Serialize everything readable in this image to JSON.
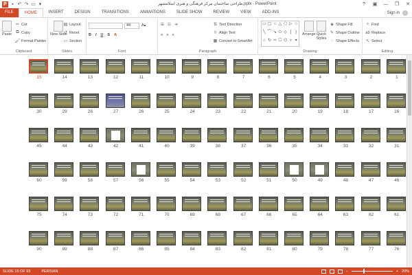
{
  "window": {
    "title": "طراحی ساختمان مرکز فرهنگی و هنری اسلامشهر.pptx - PowerPoint",
    "sign_in": "Sign in",
    "minimize": "—",
    "restore": "❐",
    "close": "✕",
    "help": "?"
  },
  "tabs": [
    "FILE",
    "HOME",
    "INSERT",
    "DESIGN",
    "TRANSITIONS",
    "ANIMATIONS",
    "SLIDE SHOW",
    "REVIEW",
    "VIEW",
    "ADD-INS"
  ],
  "ribbon": {
    "clipboard": {
      "label": "Clipboard",
      "paste": "Paste",
      "cut": "Cut",
      "copy": "Copy",
      "format_painter": "Format Painter"
    },
    "slides": {
      "label": "Slides",
      "new_slide": "New Slide",
      "layout": "Layout",
      "reset": "Reset",
      "section": "Section"
    },
    "font": {
      "label": "Font",
      "font_name": "",
      "font_size": "44"
    },
    "paragraph": {
      "label": "Paragraph",
      "text_direction": "Text Direction",
      "align_text": "Align Text",
      "convert_smartart": "Convert to SmartArt"
    },
    "drawing": {
      "label": "Drawing",
      "arrange": "Arrange",
      "quick_styles": "Quick Styles",
      "shape_fill": "Shape Fill",
      "shape_outline": "Shape Outline",
      "shape_effects": "Shape Effects"
    },
    "editing": {
      "label": "Editing",
      "find": "Find",
      "replace": "Replace",
      "select": "Select"
    }
  },
  "slides": {
    "selected": 15,
    "white_slides": [
      42,
      49,
      50,
      56
    ],
    "blue_slides": [
      27
    ],
    "numbers": [
      15,
      14,
      13,
      12,
      11,
      10,
      9,
      8,
      7,
      6,
      5,
      4,
      3,
      2,
      1,
      30,
      29,
      28,
      27,
      26,
      25,
      24,
      23,
      22,
      21,
      20,
      19,
      18,
      17,
      16,
      45,
      44,
      43,
      42,
      41,
      40,
      39,
      38,
      37,
      36,
      35,
      34,
      33,
      32,
      31,
      60,
      59,
      58,
      57,
      56,
      55,
      54,
      53,
      52,
      51,
      50,
      49,
      48,
      47,
      46,
      75,
      74,
      73,
      72,
      71,
      70,
      69,
      68,
      67,
      66,
      65,
      64,
      63,
      62,
      61,
      90,
      89,
      88,
      87,
      86,
      85,
      84,
      83,
      82,
      81,
      80,
      79,
      78,
      77,
      76
    ]
  },
  "status": {
    "slide": "SLIDE 15 OF 93",
    "language": "PERSIAN",
    "zoom": "20%",
    "zoom_minus": "−",
    "zoom_plus": "+"
  },
  "colors": {
    "accent": "#d24726"
  }
}
